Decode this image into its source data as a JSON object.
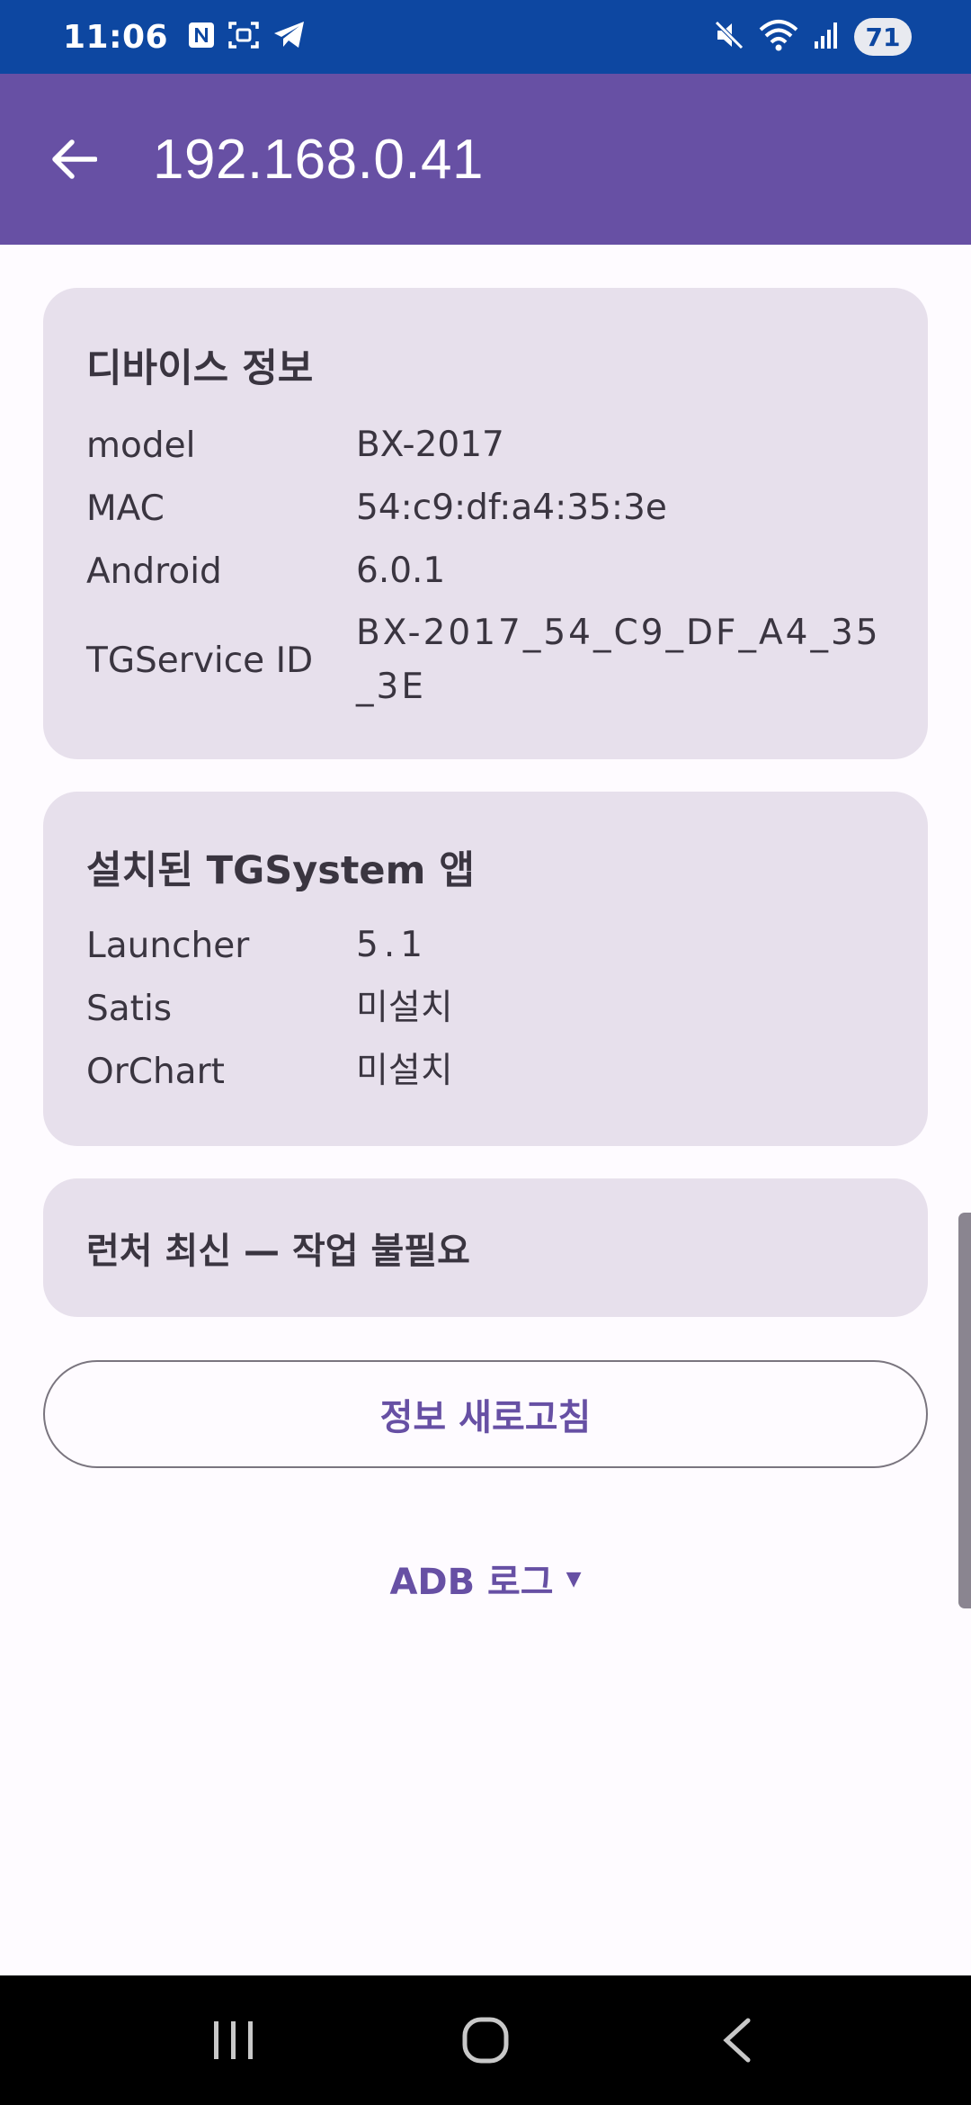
{
  "status_bar": {
    "time": "11:06",
    "battery": "71",
    "icons": [
      "n-icon",
      "screenshot-icon",
      "telegram-icon",
      "mute-icon",
      "wifi-icon",
      "signal-icon"
    ]
  },
  "app_bar": {
    "title": "192.168.0.41"
  },
  "device_info": {
    "title": "디바이스 정보",
    "rows": [
      {
        "key": "model",
        "value": "BX-2017"
      },
      {
        "key": "MAC",
        "value": "54:c9:df:a4:35:3e"
      },
      {
        "key": "Android",
        "value": "6.0.1"
      },
      {
        "key": "TGService ID",
        "value": "BX-2017_54_C9_DF_A4_35_3E"
      }
    ]
  },
  "installed_apps": {
    "title": "설치된 TGSystem 앱",
    "rows": [
      {
        "key": "Launcher",
        "value": "5.1"
      },
      {
        "key": "Satis",
        "value": "미설치"
      },
      {
        "key": "OrChart",
        "value": "미설치"
      }
    ]
  },
  "status_card": {
    "text": "런처 최신 — 작업 불필요"
  },
  "refresh_button": {
    "label": "정보 새로고침"
  },
  "adb_log": {
    "label": "ADB 로그"
  },
  "colors": {
    "status_bar": "#0d47a1",
    "app_bar": "#6750a4",
    "card_bg": "#e7e0ec",
    "accent": "#6750a4"
  }
}
